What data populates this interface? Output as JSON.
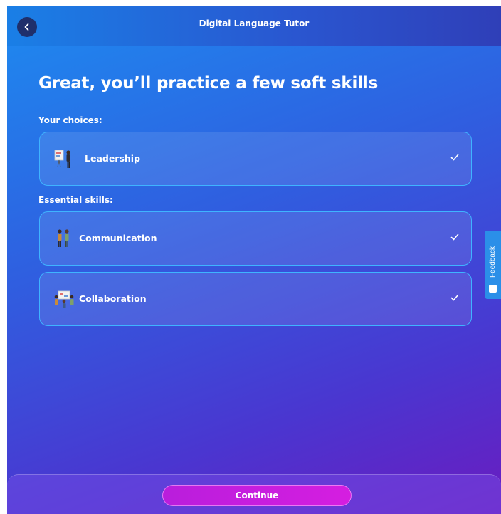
{
  "header": {
    "title": "Digital Language Tutor",
    "back_icon": "chevron-left-icon"
  },
  "main": {
    "title": "Great, you’ll practice a few soft skills",
    "your_choices_label": "Your choices:",
    "essential_label": "Essential skills:",
    "choices": [
      {
        "label": "Leadership",
        "selected": true,
        "icon": "leadership-thumbnail"
      }
    ],
    "essential": [
      {
        "label": "Communication",
        "selected": true,
        "icon": "communication-thumbnail"
      },
      {
        "label": "Collaboration",
        "selected": true,
        "icon": "collaboration-thumbnail"
      }
    ]
  },
  "feedback": {
    "label": "Feedback"
  },
  "footer": {
    "continue_label": "Continue"
  },
  "colors": {
    "card_border": "#3fb4ff",
    "continue_button": "#c41ede",
    "background_start": "#1d8bf0",
    "background_end": "#6a1cc0"
  }
}
